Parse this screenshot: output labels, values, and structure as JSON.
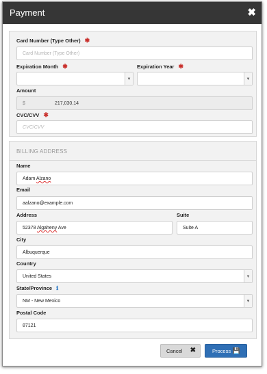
{
  "dialog": {
    "title": "Payment",
    "close_symbol": "✖"
  },
  "card": {
    "number_label": "Card Number (Type Other)",
    "number_placeholder": "Card Number (Type Other)",
    "number_value": "",
    "exp_month_label": "Expiration Month",
    "exp_month_value": "",
    "exp_year_label": "Expiration Year",
    "exp_year_value": "",
    "amount_label": "Amount",
    "currency_symbol": "$",
    "amount_value": "217,030.14",
    "cvc_label": "CVC/CVV",
    "cvc_placeholder": "CVC/CVV",
    "cvc_value": ""
  },
  "billing": {
    "section_title": "BILLING ADDRESS",
    "name_label": "Name",
    "name_first": "Adam",
    "name_last": "Alzano",
    "email_label": "Email",
    "email_value": "aalzano@example.com",
    "address_label": "Address",
    "address_number": "52378",
    "address_street": "Algaheny",
    "address_suffix": "Ave",
    "suite_label": "Suite",
    "suite_value": "Suite A",
    "city_label": "City",
    "city_value": "Albuquerque",
    "country_label": "Country",
    "country_value": "United States",
    "state_label": "State/Province",
    "state_value": "NM - New Mexico",
    "postal_label": "Postal Code",
    "postal_value": "87121"
  },
  "required_marker": "✱",
  "info_icon_symbol": "ℹ",
  "select_caret_symbol": "▼",
  "actions": {
    "cancel_label": "Cancel",
    "cancel_icon": "✖",
    "process_label": "Process",
    "process_icon": "💾"
  },
  "colors": {
    "titlebar": "#363636",
    "required": "#c9302c",
    "primary_button": "#2f6fb5",
    "info_icon": "#2f7bc7"
  }
}
